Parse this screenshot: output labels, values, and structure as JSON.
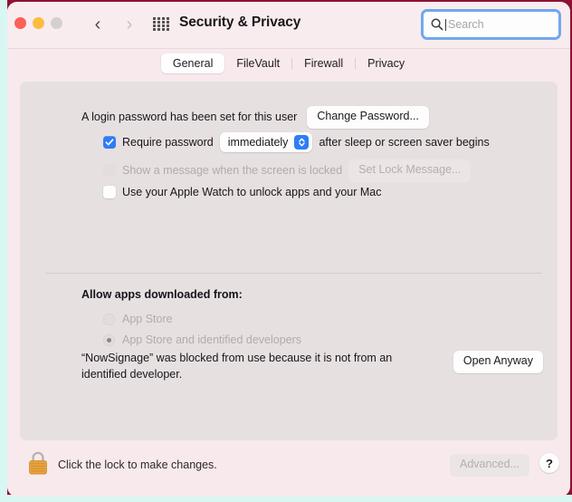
{
  "window": {
    "title": "Security & Privacy",
    "traffic_lights": [
      "close",
      "minimize",
      "zoom"
    ]
  },
  "toolbar": {
    "back_icon": "chevron-left-icon",
    "forward_icon": "chevron-right-icon",
    "grid_icon": "show-all-grid-icon",
    "search": {
      "placeholder": "Search",
      "value": "",
      "icon": "search-icon",
      "focused": true,
      "focus_color": "#70a8ef"
    }
  },
  "tabs": [
    {
      "label": "General",
      "selected": true
    },
    {
      "label": "FileVault",
      "selected": false
    },
    {
      "label": "Firewall",
      "selected": false
    },
    {
      "label": "Privacy",
      "selected": false
    }
  ],
  "general": {
    "login_password_text": "A login password has been set for this user",
    "change_password_label": "Change Password...",
    "require_password": {
      "checked": true,
      "label": "Require password",
      "delay_value": "immediately",
      "suffix": "after sleep or screen saver begins"
    },
    "lock_message": {
      "checked": false,
      "enabled": false,
      "label": "Show a message when the screen is locked",
      "button_label": "Set Lock Message..."
    },
    "apple_watch": {
      "checked": false,
      "enabled": true,
      "label": "Use your Apple Watch to unlock apps and your Mac"
    },
    "allow_apps_label": "Allow apps downloaded from:",
    "allow_apps_options": [
      {
        "label": "App Store",
        "selected": false,
        "enabled": false
      },
      {
        "label": "App Store and identified developers",
        "selected": true,
        "enabled": false
      }
    ],
    "blocked_message": "“NowSignage” was blocked from use because it is not from an identified developer.",
    "open_anyway_label": "Open Anyway"
  },
  "bottom": {
    "lock_icon": "padlock-locked-icon",
    "lock_text": "Click the lock to make changes.",
    "advanced_label": "Advanced...",
    "advanced_enabled": false,
    "help_label": "?"
  },
  "colors": {
    "accent_blue": "#2f7cf6",
    "window_bg": "#f8eaec",
    "panel_bg": "#e7e0e1",
    "lock_body": "#e8a33d"
  }
}
